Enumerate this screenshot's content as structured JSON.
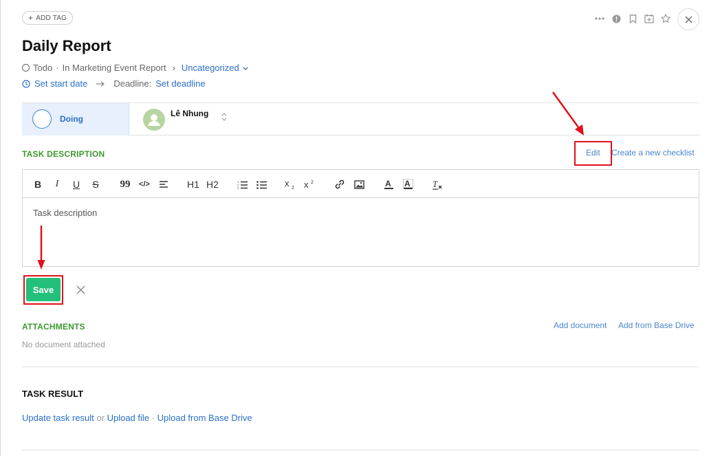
{
  "header": {
    "add_tag_label": "ADD TAG",
    "title": "Daily Report"
  },
  "meta": {
    "status": "Todo",
    "separator": "·",
    "project": "In Marketing Event Report",
    "breadcrumb_chevron": "›",
    "category": "Uncategorized",
    "set_start_date": "Set start date",
    "deadline_label": "Deadline:",
    "set_deadline": "Set deadline"
  },
  "status_row": {
    "stage": "Doing",
    "assignee": "Lê Nhung"
  },
  "task_description": {
    "label": "TASK DESCRIPTION",
    "edit_link": "Edit",
    "checklist_link": "Create a new checklist",
    "placeholder_text": "Task description"
  },
  "toolbar": {
    "bold": "B",
    "italic": "I",
    "underline": "U",
    "strike": "S",
    "blockquote": "99",
    "code": "</>",
    "align": "≡",
    "h1": "H1",
    "h2": "H2",
    "ordered_list": "1≡",
    "bullet_list": "•≡",
    "subscript": "x2",
    "superscript": "x2",
    "link": "link",
    "image": "image",
    "text_color": "A",
    "highlight": "A",
    "clear_format": "Tx"
  },
  "actions": {
    "save_label": "Save"
  },
  "attachments": {
    "label": "ATTACHMENTS",
    "add_document": "Add document",
    "add_from_drive": "Add from Base Drive",
    "empty_text": "No document attached"
  },
  "task_result": {
    "label": "TASK RESULT",
    "update_link": "Update task result",
    "or_text": "or",
    "upload_file": "Upload file",
    "dot": "·",
    "upload_drive": "Upload from Base Drive"
  },
  "colors": {
    "accent_blue": "#2a6fc9",
    "section_green": "#3d9a2f",
    "save_green": "#22c07a",
    "annotation_red": "#e0101a"
  }
}
